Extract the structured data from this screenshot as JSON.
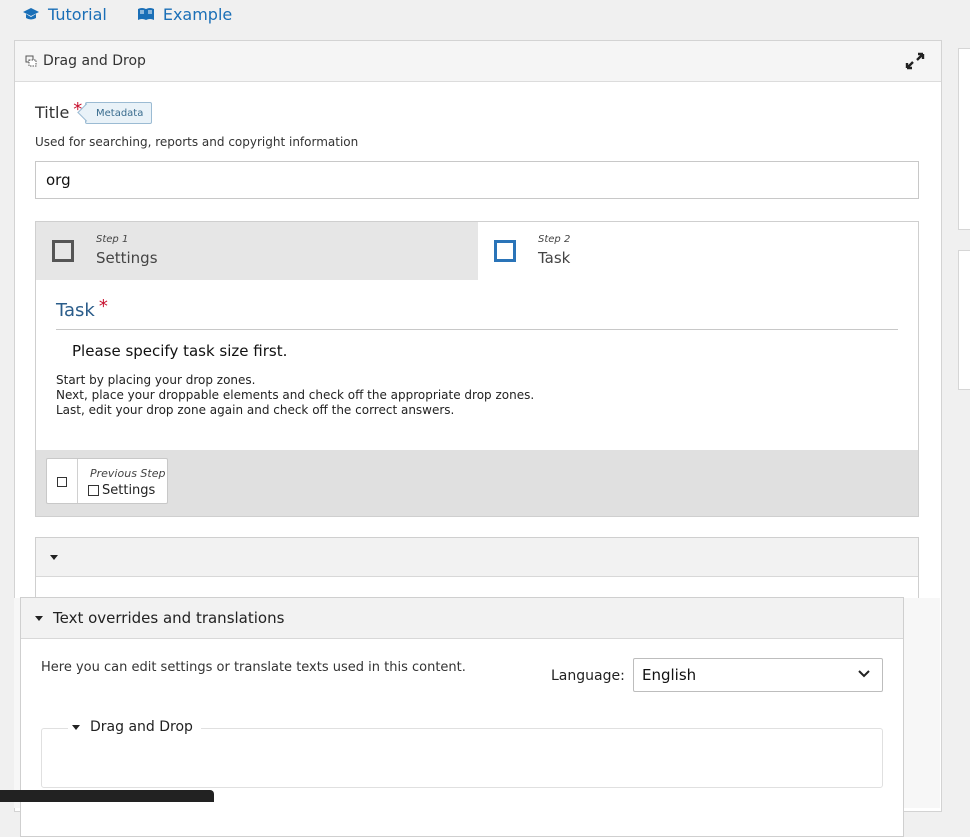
{
  "topnav": {
    "tutorial_label": "Tutorial",
    "example_label": "Example"
  },
  "editor": {
    "library_title": "Drag and Drop"
  },
  "title_field": {
    "label": "Title",
    "required_mark": "*",
    "metadata_badge": "Metadata",
    "description": "Used for searching, reports and copyright information",
    "value": "org"
  },
  "wizard": {
    "steps": [
      {
        "small": "Step 1",
        "label": "Settings"
      },
      {
        "small": "Step 2",
        "label": "Task"
      }
    ],
    "task_heading": "Task",
    "required_mark": "*",
    "message": "Please specify task size first.",
    "help_lines": [
      "Start by placing your drop zones.",
      "Next, place your droppable elements and check off the appropriate drop zones.",
      "Last, edit your drop zone again and check off the correct answers."
    ],
    "prev_small": "Previous Step",
    "prev_label": "Settings"
  },
  "overrides": {
    "heading": "Text overrides and translations",
    "description": "Here you can edit settings or translate texts used in this content.",
    "language_label": "Language:",
    "language_value": "English",
    "subgroup_label": "Drag and Drop"
  },
  "colors": {
    "link": "#1a6fb7",
    "required": "#c8102e",
    "step_active": "#2a74b8",
    "task_heading": "#2a5c8a"
  }
}
